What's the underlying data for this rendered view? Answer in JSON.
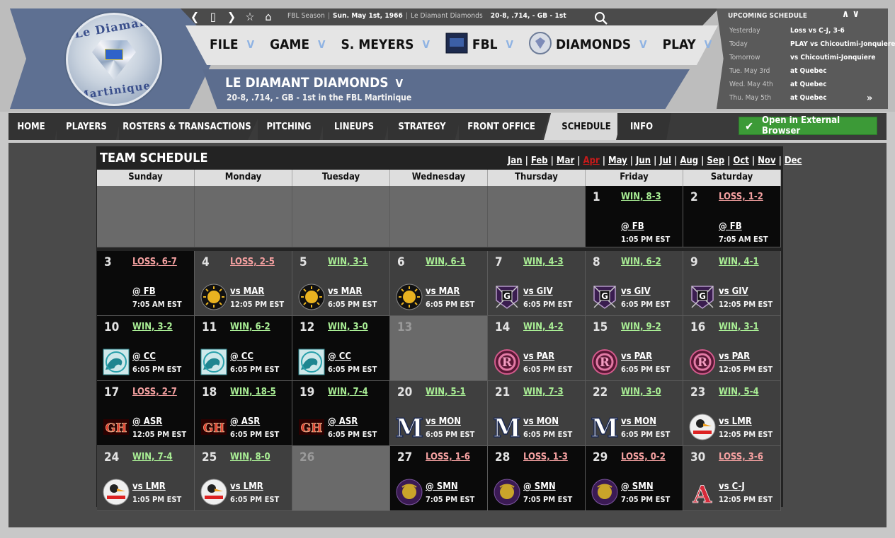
{
  "toolbar": {
    "nav_icons": [
      "back-icon",
      "window-icon",
      "forward-icon",
      "star-icon",
      "home-icon"
    ],
    "info": [
      "FBL Season",
      "Sun. May 1st, 1966",
      "Le Diamant Diamonds",
      "20-8, .714, - GB - 1st"
    ]
  },
  "logo": {
    "top": "Le Diamant",
    "bottom": "Martinique"
  },
  "main_menu": [
    {
      "label": "FILE"
    },
    {
      "label": "GAME"
    },
    {
      "label": "S. MEYERS"
    },
    {
      "label": "FBL"
    },
    {
      "label": "DIAMONDS"
    },
    {
      "label": "PLAY"
    }
  ],
  "team": {
    "name": "LE DIAMANT DIAMONDS",
    "subtitle": "20-8, .714, - GB - 1st in the FBL Martinique"
  },
  "upcoming": {
    "title": "UPCOMING SCHEDULE",
    "rows": [
      {
        "day": "Yesterday",
        "text": "Loss vs C-J, 3-6"
      },
      {
        "day": "Today",
        "text": "PLAY vs Chicoutimi-Jonquiere"
      },
      {
        "day": "Tomorrow",
        "text": "vs Chicoutimi-Jonquiere"
      },
      {
        "day": "Tue. May 3rd",
        "text": "at Quebec"
      },
      {
        "day": "Wed. May 4th",
        "text": "at Quebec"
      },
      {
        "day": "Thu. May 5th",
        "text": "at Quebec"
      }
    ]
  },
  "tabs": [
    "HOME",
    "PLAYERS",
    "ROSTERS & TRANSACTIONS",
    "PITCHING",
    "LINEUPS",
    "STRATEGY",
    "FRONT OFFICE",
    "SCHEDULE",
    "INFO"
  ],
  "active_tab": "SCHEDULE",
  "external_button": "Open in External Browser",
  "schedule": {
    "title": "TEAM SCHEDULE",
    "months": [
      "Jan",
      "Feb",
      "Mar",
      "Apr",
      "May",
      "Jun",
      "Jul",
      "Aug",
      "Sep",
      "Oct",
      "Nov",
      "Dec"
    ],
    "current_month": "Apr",
    "days_of_week": [
      "Sunday",
      "Monday",
      "Tuesday",
      "Wednesday",
      "Thursday",
      "Friday",
      "Saturday"
    ],
    "weeks": [
      [
        null,
        null,
        null,
        null,
        null,
        {
          "day": "1",
          "result": "WIN, 8-3",
          "outcome": "win",
          "opponent": "@ FB",
          "time": "1:05 PM EST",
          "venue": "away",
          "logo": ""
        },
        {
          "day": "2",
          "result": "LOSS, 1-2",
          "outcome": "loss",
          "opponent": "@ FB",
          "time": "7:05 AM EST",
          "venue": "away",
          "logo": ""
        }
      ],
      [
        {
          "day": "3",
          "result": "LOSS, 6-7",
          "outcome": "loss",
          "opponent": "@ FB",
          "time": "7:05 AM EST",
          "venue": "away",
          "logo": ""
        },
        {
          "day": "4",
          "result": "LOSS, 2-5",
          "outcome": "loss",
          "opponent": "vs MAR",
          "time": "12:05 PM EST",
          "venue": "home",
          "logo": "sun"
        },
        {
          "day": "5",
          "result": "WIN, 3-1",
          "outcome": "win",
          "opponent": "vs MAR",
          "time": "6:05 PM EST",
          "venue": "home",
          "logo": "sun"
        },
        {
          "day": "6",
          "result": "WIN, 6-1",
          "outcome": "win",
          "opponent": "vs MAR",
          "time": "6:05 PM EST",
          "venue": "home",
          "logo": "sun"
        },
        {
          "day": "7",
          "result": "WIN, 4-3",
          "outcome": "win",
          "opponent": "vs GIV",
          "time": "6:05 PM EST",
          "venue": "home",
          "logo": "g"
        },
        {
          "day": "8",
          "result": "WIN, 6-2",
          "outcome": "win",
          "opponent": "vs GIV",
          "time": "6:05 PM EST",
          "venue": "home",
          "logo": "g"
        },
        {
          "day": "9",
          "result": "WIN, 4-1",
          "outcome": "win",
          "opponent": "vs GIV",
          "time": "12:05 PM EST",
          "venue": "home",
          "logo": "g"
        }
      ],
      [
        {
          "day": "10",
          "result": "WIN, 3-2",
          "outcome": "win",
          "opponent": "@ CC",
          "time": "6:05 PM EST",
          "venue": "away",
          "logo": "wave"
        },
        {
          "day": "11",
          "result": "WIN, 6-2",
          "outcome": "win",
          "opponent": "@ CC",
          "time": "6:05 PM EST",
          "venue": "away",
          "logo": "wave"
        },
        {
          "day": "12",
          "result": "WIN, 3-0",
          "outcome": "win",
          "opponent": "@ CC",
          "time": "6:05 PM EST",
          "venue": "away",
          "logo": "wave"
        },
        {
          "day": "13",
          "off": true
        },
        {
          "day": "14",
          "result": "WIN, 4-2",
          "outcome": "win",
          "opponent": "vs PAR",
          "time": "6:05 PM EST",
          "venue": "home",
          "logo": "r"
        },
        {
          "day": "15",
          "result": "WIN, 9-2",
          "outcome": "win",
          "opponent": "vs PAR",
          "time": "6:05 PM EST",
          "venue": "home",
          "logo": "r"
        },
        {
          "day": "16",
          "result": "WIN, 3-1",
          "outcome": "win",
          "opponent": "vs PAR",
          "time": "12:05 PM EST",
          "venue": "home",
          "logo": "r"
        }
      ],
      [
        {
          "day": "17",
          "result": "LOSS, 2-7",
          "outcome": "loss",
          "opponent": "@ ASR",
          "time": "12:05 PM EST",
          "venue": "away",
          "logo": "gh"
        },
        {
          "day": "18",
          "result": "WIN, 18-5",
          "outcome": "win",
          "opponent": "@ ASR",
          "time": "6:05 PM EST",
          "venue": "away",
          "logo": "gh"
        },
        {
          "day": "19",
          "result": "WIN, 7-4",
          "outcome": "win",
          "opponent": "@ ASR",
          "time": "6:05 PM EST",
          "venue": "away",
          "logo": "gh"
        },
        {
          "day": "20",
          "result": "WIN, 5-1",
          "outcome": "win",
          "opponent": "vs MON",
          "time": "6:05 PM EST",
          "venue": "home",
          "logo": "m"
        },
        {
          "day": "21",
          "result": "WIN, 7-3",
          "outcome": "win",
          "opponent": "vs MON",
          "time": "6:05 PM EST",
          "venue": "home",
          "logo": "m"
        },
        {
          "day": "22",
          "result": "WIN, 3-0",
          "outcome": "win",
          "opponent": "vs MON",
          "time": "6:05 PM EST",
          "venue": "home",
          "logo": "m"
        },
        {
          "day": "23",
          "result": "WIN, 5-4",
          "outcome": "win",
          "opponent": "vs LMR",
          "time": "12:05 PM EST",
          "venue": "home",
          "logo": "bird"
        }
      ],
      [
        {
          "day": "24",
          "result": "WIN, 7-4",
          "outcome": "win",
          "opponent": "vs LMR",
          "time": "1:05 PM EST",
          "venue": "home",
          "logo": "bird"
        },
        {
          "day": "25",
          "result": "WIN, 8-0",
          "outcome": "win",
          "opponent": "vs LMR",
          "time": "6:05 PM EST",
          "venue": "home",
          "logo": "bird"
        },
        {
          "day": "26",
          "off": true
        },
        {
          "day": "27",
          "result": "LOSS, 1-6",
          "outcome": "loss",
          "opponent": "@ SMN",
          "time": "7:05 PM EST",
          "venue": "away",
          "logo": "purple"
        },
        {
          "day": "28",
          "result": "LOSS, 1-3",
          "outcome": "loss",
          "opponent": "@ SMN",
          "time": "7:05 PM EST",
          "venue": "away",
          "logo": "purple"
        },
        {
          "day": "29",
          "result": "LOSS, 0-2",
          "outcome": "loss",
          "opponent": "@ SMN",
          "time": "7:05 PM EST",
          "venue": "away",
          "logo": "purple"
        },
        {
          "day": "30",
          "result": "LOSS, 3-6",
          "outcome": "loss",
          "opponent": "vs C-J",
          "time": "12:05 PM EST",
          "venue": "home",
          "logo": "a"
        }
      ]
    ]
  },
  "colors": {
    "win": "#a9ee95",
    "loss": "#f4a0a0",
    "header_blue": "#5c6d8e",
    "active_month": "#c81a1a",
    "ext_button": "#3c9a37"
  }
}
